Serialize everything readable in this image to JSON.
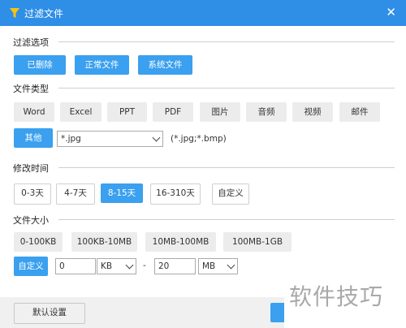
{
  "window": {
    "title": "过滤文件",
    "close_glyph": "✕"
  },
  "filter_options": {
    "section_label": "过滤选项",
    "buttons": [
      "已删除",
      "正常文件",
      "系统文件"
    ]
  },
  "file_type": {
    "section_label": "文件类型",
    "buttons": [
      "Word",
      "Excel",
      "PPT",
      "PDF",
      "图片",
      "音频",
      "视频",
      "邮件"
    ],
    "other_label": "其他",
    "ext_value": "*.jpg",
    "ext_hint": "(*.jpg;*.bmp)"
  },
  "modified_time": {
    "section_label": "修改时间",
    "buttons": [
      "0-3天",
      "4-7天",
      "8-15天",
      "16-310天",
      "自定义"
    ],
    "selected": "8-15天"
  },
  "file_size": {
    "section_label": "文件大小",
    "buttons": [
      "0-100KB",
      "100KB-10MB",
      "10MB-100MB",
      "100MB-1GB"
    ],
    "custom_label": "自定义",
    "min_value": "0",
    "min_unit": "KB",
    "dash": "-",
    "max_value": "20",
    "max_unit": "MB"
  },
  "footer": {
    "default_settings_label": "默认设置"
  },
  "watermark": {
    "text": "软件技巧"
  },
  "colors": {
    "accent": "#3aa0ef",
    "titlebar": "#2f8ee6"
  }
}
